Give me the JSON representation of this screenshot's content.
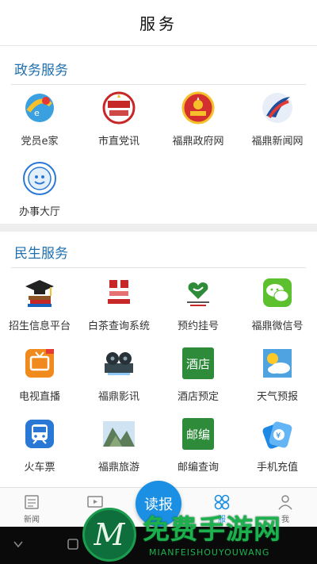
{
  "header": {
    "title": "服务"
  },
  "gov_section": {
    "title": "政务服务",
    "items": [
      {
        "label": "党员e家",
        "icon": "party-member-home-icon"
      },
      {
        "label": "市直党讯",
        "icon": "party-news-icon"
      },
      {
        "label": "福鼎政府网",
        "icon": "government-emblem-icon"
      },
      {
        "label": "福鼎新闻网",
        "icon": "news-logo-icon"
      },
      {
        "label": "办事大厅",
        "icon": "service-hall-seal-icon"
      }
    ]
  },
  "people_section": {
    "title": "民生服务",
    "items": [
      {
        "label": "招生信息平台",
        "icon": "graduation-cap-icon"
      },
      {
        "label": "白茶查询系统",
        "icon": "white-tea-icon"
      },
      {
        "label": "预约挂号",
        "icon": "hospital-heart-icon"
      },
      {
        "label": "福鼎微信号",
        "icon": "wechat-icon"
      },
      {
        "label": "电视直播",
        "icon": "tv-live-icon"
      },
      {
        "label": "福鼎影讯",
        "icon": "film-reel-icon"
      },
      {
        "label": "酒店预定",
        "icon": "hotel-icon",
        "icon_text": "酒店"
      },
      {
        "label": "天气预报",
        "icon": "weather-icon"
      },
      {
        "label": "火车票",
        "icon": "train-icon"
      },
      {
        "label": "福鼎旅游",
        "icon": "travel-landscape-icon"
      },
      {
        "label": "邮编查询",
        "icon": "postcode-icon",
        "icon_text": "邮编"
      },
      {
        "label": "手机充值",
        "icon": "phone-recharge-icon"
      }
    ]
  },
  "tabbar": {
    "news": "新闻",
    "video": "视",
    "center": "读报",
    "service": "服",
    "mine": "我"
  },
  "watermark": {
    "text": "免费手游网",
    "sub": "MIANFEISHOUYOUWANG",
    "logo_letter": "M"
  },
  "colors": {
    "accent": "#1f6fae",
    "tab_active": "#1a8fe3",
    "hotel_green": "#2e8b3a",
    "wechat_green": "#5cc02f",
    "tv_orange": "#f08a1c",
    "train_blue": "#2a78d6"
  }
}
